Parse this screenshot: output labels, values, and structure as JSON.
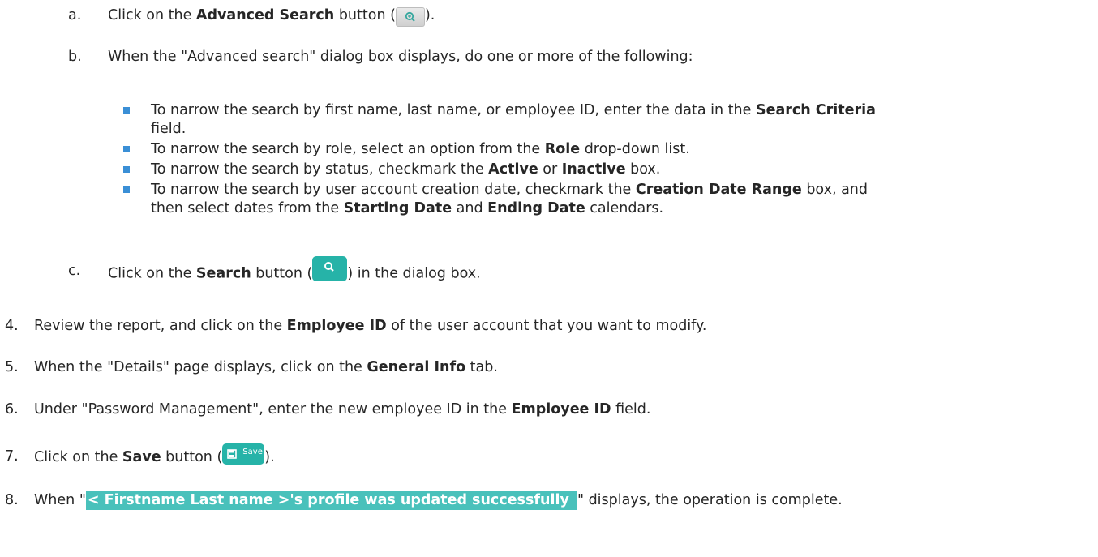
{
  "steps": {
    "a": {
      "marker": "a.",
      "pre": "Click on the ",
      "bold": "Advanced Search",
      "mid": " button (",
      "post": ")."
    },
    "b": {
      "marker": "b.",
      "text": "When the \"Advanced search\" dialog box displays, do one or more of the following:"
    },
    "bullets": {
      "b1": {
        "pre": "To narrow the search by first name, last name, or employee ID, enter the data in the ",
        "bold": "Search Criteria",
        "cont": "field."
      },
      "b2": {
        "pre": "To narrow the search by role, select an option from the ",
        "bold": "Role",
        "post": " drop-down list."
      },
      "b3": {
        "pre": "To narrow the search by status, checkmark the ",
        "bold1": "Active",
        "mid": " or ",
        "bold2": "Inactive",
        "post": " box."
      },
      "b4": {
        "pre": "To narrow the search by user account creation date, checkmark the ",
        "bold1": "Creation Date Range",
        "post": " box, and",
        "cont_pre": "then select dates from the ",
        "bold2": "Starting Date",
        "mid": " and ",
        "bold3": "Ending Date",
        "cont_post": " calendars."
      }
    },
    "c": {
      "marker": "c.",
      "pre": "Click on the ",
      "bold": "Search",
      "mid": " button (",
      "post": ") in the dialog box."
    },
    "s4": {
      "marker": "4.",
      "pre": "Review the report, and click on the ",
      "bold": "Employee ID",
      "post": " of the user account that you want to modify."
    },
    "s5": {
      "marker": "5.",
      "pre": "When the \"Details\" page displays, click on the ",
      "bold": "General Info",
      "post": " tab."
    },
    "s6": {
      "marker": "6.",
      "pre": "Under \"Password Management\", enter the new employee ID in the ",
      "bold": "Employee ID",
      "post": " field."
    },
    "s7": {
      "marker": "7.",
      "pre": "Click on the ",
      "bold": "Save",
      "mid": " button (",
      "post": ").",
      "save_label": "Save"
    },
    "s8": {
      "marker": "8.",
      "pre": "When \"",
      "highlight": "< Firstname Last name >'s profile was updated successfully ",
      "post": "\" displays, the operation is complete."
    }
  },
  "icons": {
    "advanced_search": "zoom-in-magnifier-icon",
    "search": "magnifier-icon",
    "save": "floppy-disk-icon"
  },
  "colors": {
    "button_teal": "#26b3a8",
    "highlight": "#49c1bb",
    "bullet": "#3a8fd6",
    "text": "#262626"
  }
}
